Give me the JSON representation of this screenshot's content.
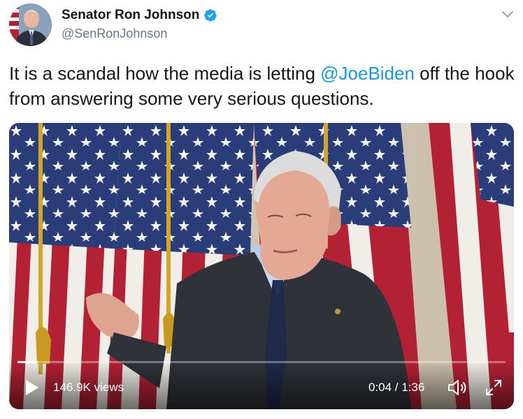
{
  "author": {
    "name": "Senator Ron Johnson",
    "handle": "@SenRonJohnson",
    "verified": true
  },
  "tweet": {
    "text_before": "It is a scandal how the media is letting ",
    "mention": "@JoeBiden",
    "text_after": " off the hook from answering some very serious questions."
  },
  "video": {
    "views": "146.9K views",
    "time": "0:04 / 1:36",
    "progress": 0.042
  },
  "colors": {
    "link": "#1b95e0",
    "verified": "#1da1f2"
  },
  "icons": [
    "verified-badge-icon",
    "chevron-down-icon",
    "play-icon",
    "volume-icon",
    "fullscreen-icon"
  ]
}
